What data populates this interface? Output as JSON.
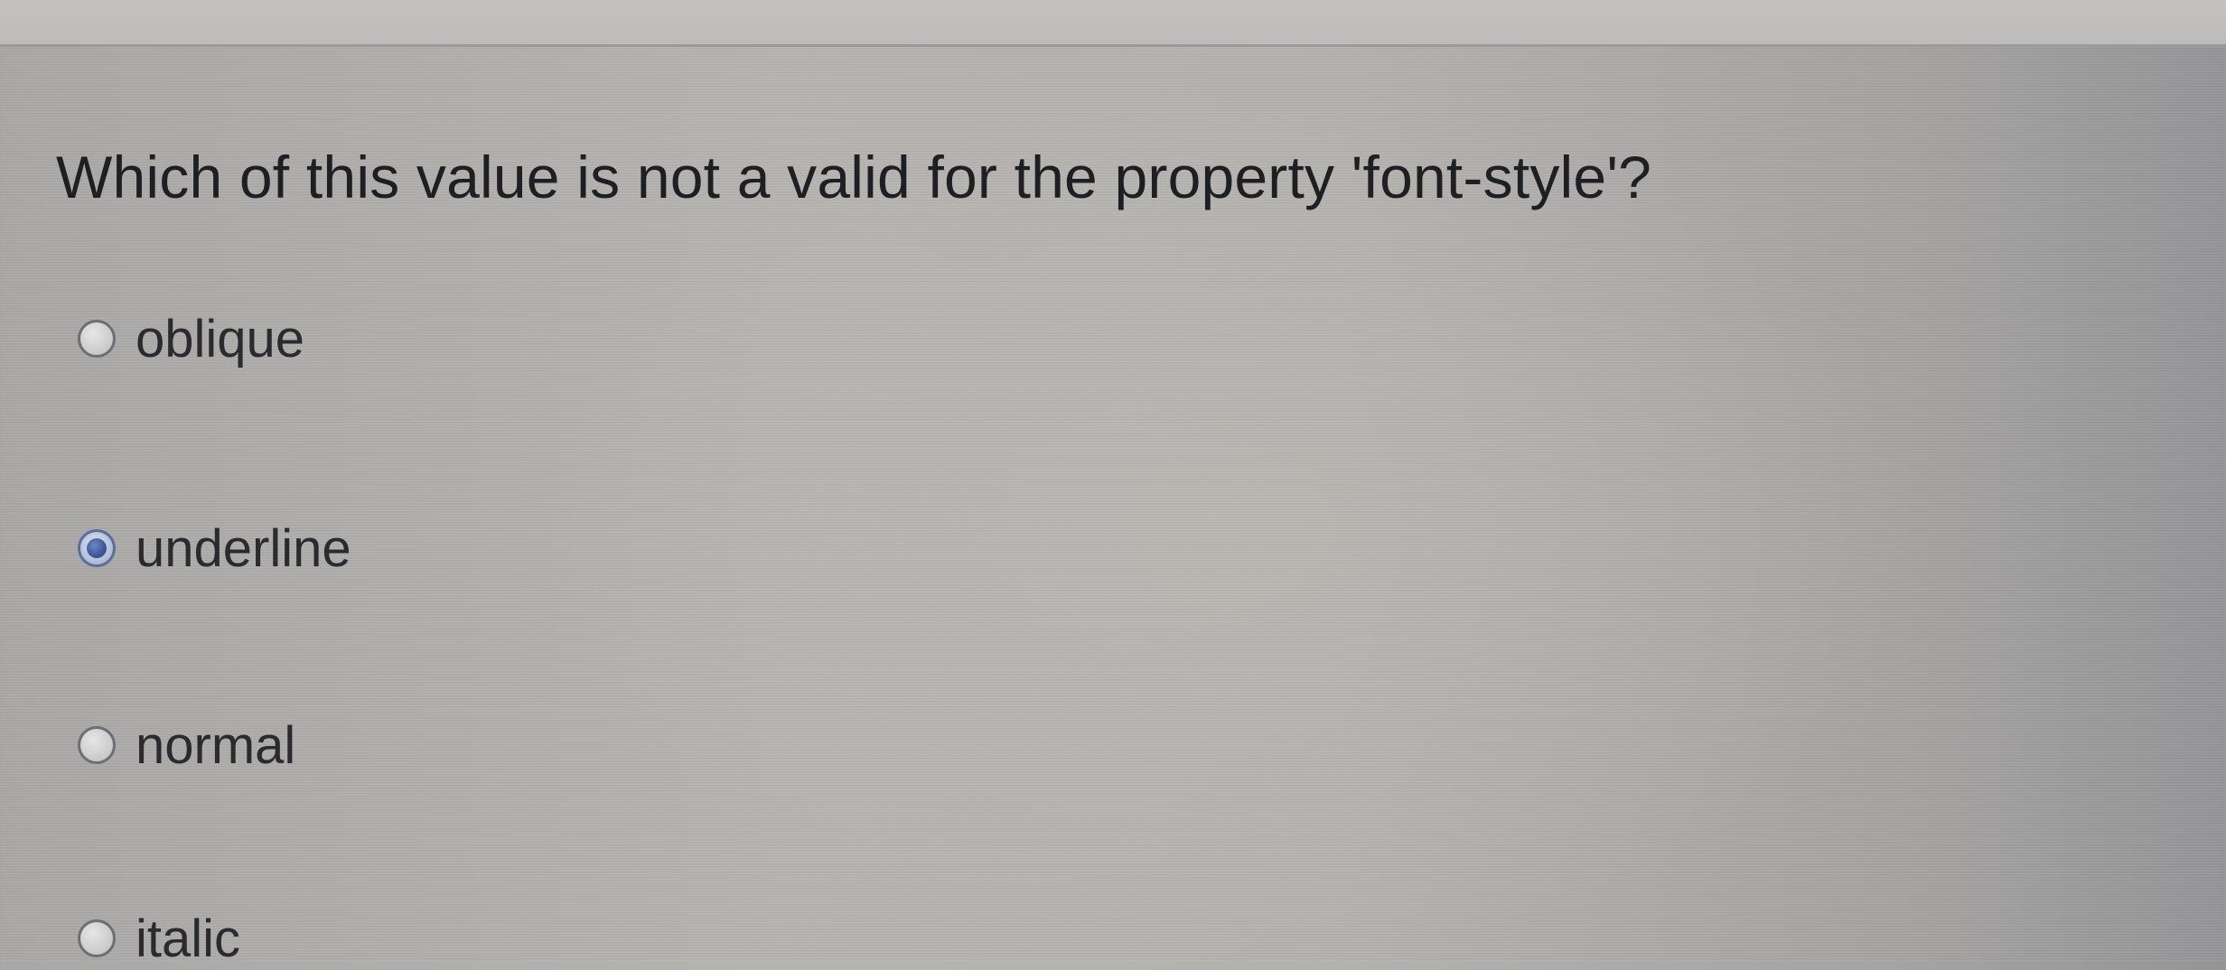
{
  "quiz": {
    "question": "Which of this value is not a valid for the property 'font-style'?",
    "selected_index": 1,
    "options": [
      {
        "label": "oblique",
        "checked": false
      },
      {
        "label": "underline",
        "checked": true
      },
      {
        "label": "normal",
        "checked": false
      },
      {
        "label": "italic",
        "checked": false
      }
    ]
  },
  "colors": {
    "radio_checked": "#3d559b",
    "text": "#1e1f22"
  }
}
